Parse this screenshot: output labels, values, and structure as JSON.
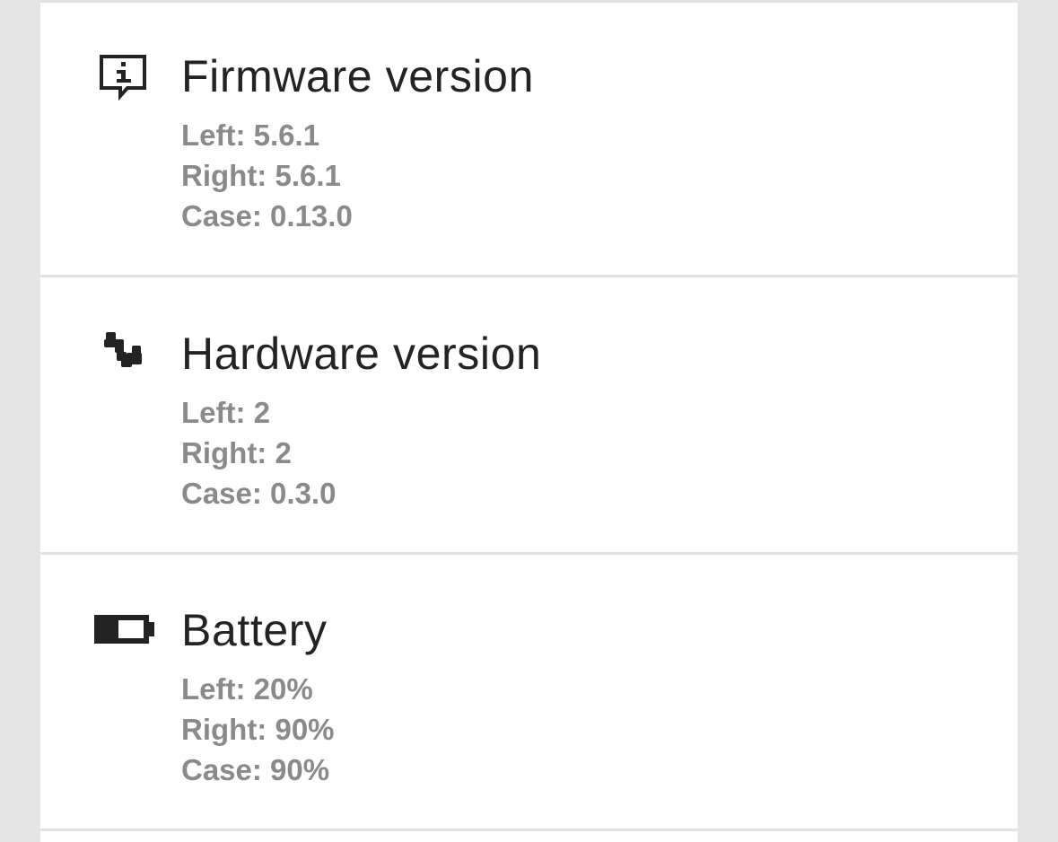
{
  "colors": {
    "background": "#e4e4e4",
    "card": "#fefefe",
    "title": "#232323",
    "detail": "#8a8a8a",
    "divider": "#e2e2e2"
  },
  "rows": [
    {
      "icon": "info-chat-icon",
      "title": "Firmware version",
      "details": [
        "Left: 5.6.1",
        "Right: 5.6.1",
        "Case: 0.13.0"
      ]
    },
    {
      "icon": "puzzle-icon",
      "title": "Hardware version",
      "details": [
        "Left: 2",
        "Right: 2",
        "Case: 0.3.0"
      ]
    },
    {
      "icon": "battery-low-icon",
      "title": "Battery",
      "details": [
        "Left: 20%",
        "Right: 90%",
        "Case: 90%"
      ]
    }
  ]
}
